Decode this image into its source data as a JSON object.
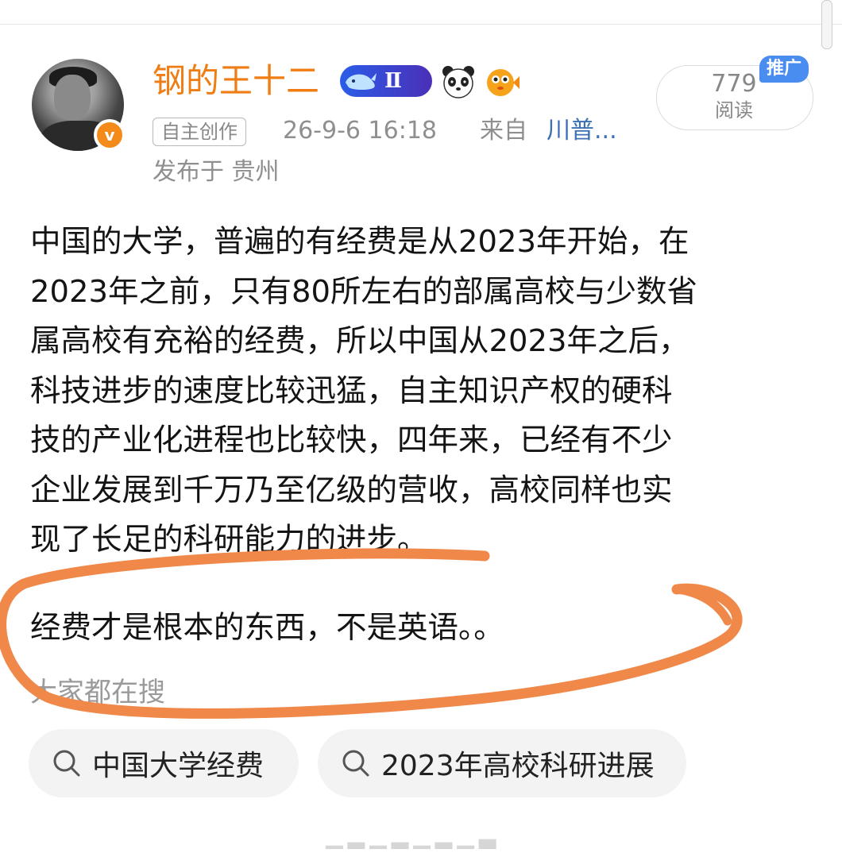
{
  "author": {
    "username": "钢的王十二",
    "verified_badge": "v",
    "whale_level_badge": "Ⅱ",
    "badge_icons": [
      "whale-level-icon",
      "panda-icon",
      "pufferfish-icon"
    ]
  },
  "meta": {
    "original_tag": "自主创作",
    "time": "26-9-6 16:18",
    "from_label": "来自",
    "source": "川普...",
    "location": "发布于 贵州"
  },
  "stats": {
    "read_count": "779",
    "read_label": "阅读",
    "promo_tag": "推广"
  },
  "post": {
    "lines": [
      "中国的大学，普遍的有经费是从2023年开始，在",
      "2023年之前，只有80所左右的部属高校与少数省",
      "属高校有充裕的经费，所以中国从2023年之后，",
      "科技进步的速度比较迅猛，自主知识产权的硬科",
      "技的产业化进程也比较快，四年来，已经有不少",
      "企业发展到千万乃至亿级的营收，高校同样也实",
      "现了长足的科研能力的进步。"
    ],
    "highlighted": "经费才是根本的东西，不是英语。。"
  },
  "search": {
    "label": "大家都在搜",
    "chips": [
      "中国大学经费",
      "2023年高校科研进展"
    ]
  },
  "colors": {
    "username": "#f07d14",
    "source_link": "#3c6fb5",
    "annotation": "#f0884a",
    "promo": "#4a8df0"
  }
}
